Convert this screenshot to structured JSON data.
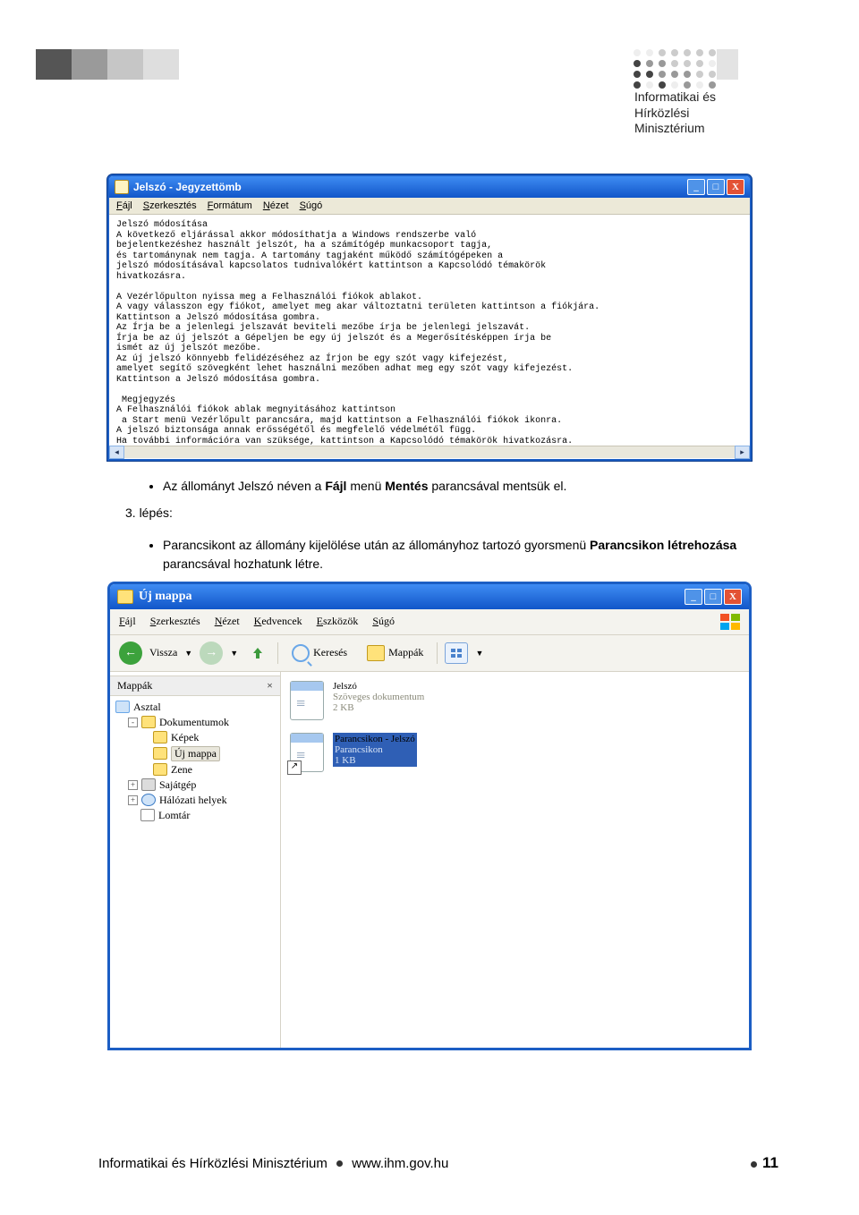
{
  "header": {
    "org_line1": "Informatikai és",
    "org_line2": "Hírközlési",
    "org_line3": "Minisztérium"
  },
  "notepad": {
    "title": "Jelszó - Jegyzettömb",
    "menu": [
      "Fájl",
      "Szerkesztés",
      "Formátum",
      "Nézet",
      "Súgó"
    ],
    "text": "Jelszó módosítása\nA következő eljárással akkor módosíthatja a Windows rendszerbe való\nbejelentkezéshez használt jelszót, ha a számítógép munkacsoport tagja,\nés tartománynak nem tagja. A tartomány tagjaként működő számítógépeken a\njelszó módosításával kapcsolatos tudnivalókért kattintson a Kapcsolódó témakörök\nhivatkozásra.\n\nA Vezérlőpulton nyissa meg a Felhasználói fiókok ablakot.\nA vagy válasszon egy fiókot, amelyet meg akar változtatni területen kattintson a fiókjára.\nKattintson a Jelszó módosítása gombra.\nAz Írja be a jelenlegi jelszavát beviteli mezőbe írja be jelenlegi jelszavát.\nÍrja be az új jelszót a Gépeljen be egy új jelszót és a Megerősítésképpen írja be\nismét az új jelszót mezőbe.\nAz új jelszó könnyebb felidézéséhez az Írjon be egy szót vagy kifejezést,\namelyet segítő szövegként lehet használni mezőben adhat meg egy szót vagy kifejezést.\nKattintson a Jelszó módosítása gombra.\n\n Megjegyzés\nA Felhasználói fiókok ablak megnyitásához kattintson\n a Start menü Vezérlőpult parancsára, majd kattintson a Felhasználói fiókok ikonra.\nA jelszó biztonsága annak erősségétől és megfelelő védelmétől függ.\nHa további információra van szüksége, kattintson a Kapcsolódó témakörök hivatkozásra."
  },
  "instructions": {
    "bullet1_pre": "Az állományt Jelszó néven a ",
    "bullet1_b1": "Fájl",
    "bullet1_mid": " menü ",
    "bullet1_b2": "Mentés",
    "bullet1_post": " parancsával mentsük el.",
    "step_label": "3. lépés:",
    "bullet2_pre": "Parancsikont az állomány kijelölése után az állományhoz tartozó gyorsmenü ",
    "bullet2_b": "Parancsikon létrehozása",
    "bullet2_post": " parancsával hozhatunk létre."
  },
  "explorer": {
    "title": "Új mappa",
    "menu": [
      "Fájl",
      "Szerkesztés",
      "Nézet",
      "Kedvencek",
      "Eszközök",
      "Súgó"
    ],
    "toolbar": {
      "back": "Vissza",
      "search": "Keresés",
      "folders": "Mappák"
    },
    "side_header": "Mappák",
    "tree": {
      "desktop": "Asztal",
      "documents": "Dokumentumok",
      "pictures": "Képek",
      "newfolder": "Új mappa",
      "music": "Zene",
      "mycomputer": "Sajátgép",
      "network": "Hálózati helyek",
      "recycle": "Lomtár"
    },
    "files": {
      "f1_name": "Jelszó",
      "f1_type": "Szöveges dokumentum",
      "f1_size": "2 KB",
      "f2_name": "Parancsikon - Jelszó",
      "f2_type": "Parancsikon",
      "f2_size": "1 KB"
    }
  },
  "footer": {
    "left": "Informatikai és Hírközlési Minisztérium",
    "url": "www.ihm.gov.hu",
    "page": "11"
  }
}
